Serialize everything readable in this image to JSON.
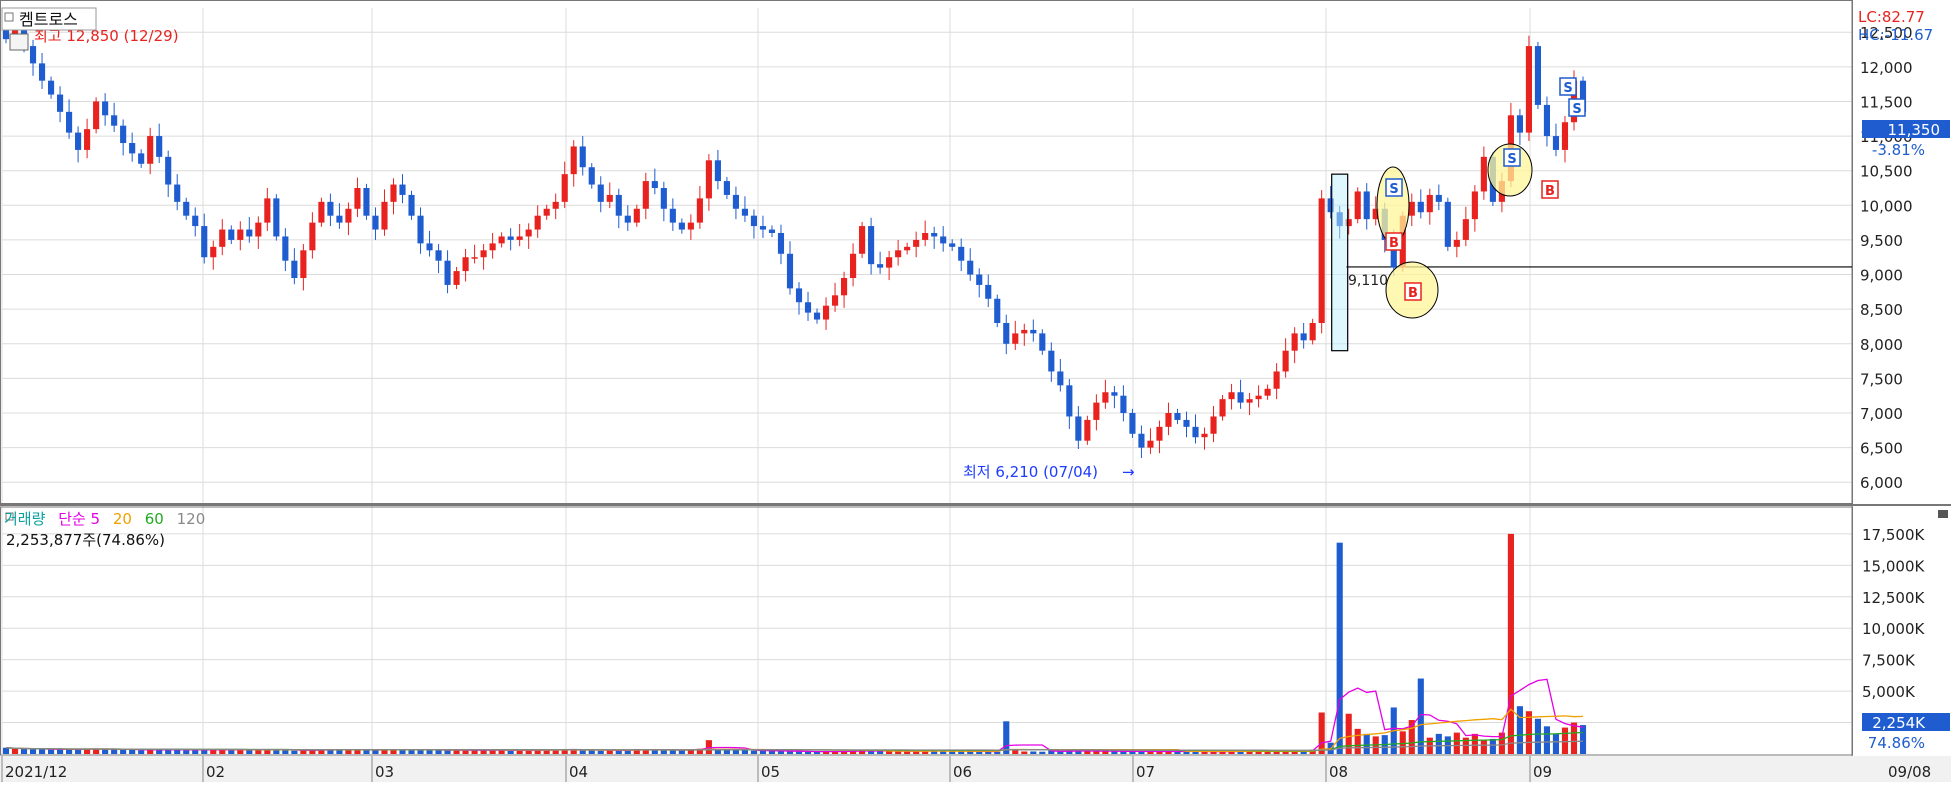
{
  "stock": {
    "name": "켐트로스",
    "high_label": "최고 12,850 (12/29)",
    "low_label": "최저 6,210 (07/04)",
    "lc_label": "LC:82.77",
    "hc_label": "HC:-11.67",
    "last_price": "11,350",
    "change_pct": "-3.81%",
    "support_label": "9,110"
  },
  "volume_panel": {
    "title": "거래량",
    "ma_labels": [
      "단순 5",
      "20",
      "60",
      "120"
    ],
    "info": "2,253,877주(74.86%)",
    "last_volume": "2,254K",
    "last_pct": "74.86%"
  },
  "colors": {
    "up": "#e8231f",
    "down": "#1e5ccf",
    "grid": "#dcdcdc",
    "ma5": "#e400e4",
    "ma20": "#f0a000",
    "ma60": "#22aa22",
    "ma120": "#888888",
    "highlight": "#fff59a"
  },
  "chart_data": [
    {
      "type": "candlestick",
      "title": "켐트로스",
      "x_tick_labels": [
        "2021/12",
        "02",
        "03",
        "04",
        "05",
        "06",
        "07",
        "08",
        "09",
        "09/08"
      ],
      "y_ticks": [
        6000,
        6500,
        7000,
        7500,
        8000,
        8500,
        9000,
        9500,
        10000,
        10500,
        11000,
        11500,
        12000,
        12500
      ],
      "y_tick_labels": [
        "6,000",
        "6,500",
        "7,000",
        "7,500",
        "8,000",
        "8,500",
        "9,000",
        "9,500",
        "10,000",
        "10,500",
        "11,000",
        "11,500",
        "12,000",
        "12,500"
      ],
      "ylim": [
        5700,
        12850
      ],
      "grid": true,
      "close": [
        12400,
        12600,
        12300,
        12050,
        11800,
        11600,
        11350,
        11050,
        10800,
        11100,
        11500,
        11300,
        11150,
        10900,
        10750,
        10600,
        11000,
        10700,
        10300,
        10050,
        9850,
        9700,
        9250,
        9400,
        9650,
        9500,
        9650,
        9550,
        9750,
        10100,
        9550,
        9200,
        8950,
        9350,
        9750,
        10050,
        9850,
        9750,
        9950,
        10250,
        9850,
        9650,
        10050,
        10300,
        10150,
        9850,
        9450,
        9350,
        9200,
        8850,
        9050,
        9250,
        9250,
        9350,
        9450,
        9550,
        9500,
        9550,
        9650,
        9850,
        9950,
        10050,
        10450,
        10850,
        10550,
        10300,
        10050,
        10150,
        9850,
        9750,
        9950,
        10350,
        10250,
        9950,
        9750,
        9650,
        9750,
        10100,
        10650,
        10350,
        10150,
        9950,
        9850,
        9700,
        9650,
        9600,
        9300,
        8800,
        8600,
        8450,
        8350,
        8550,
        8700,
        8950,
        9300,
        9700,
        9150,
        9100,
        9250,
        9350,
        9400,
        9500,
        9600,
        9550,
        9450,
        9400,
        9200,
        9000,
        8850,
        8650,
        8300,
        8000,
        8150,
        8200,
        8150,
        7900,
        7600,
        7400,
        6950,
        6600,
        6900,
        7150,
        7300,
        7250,
        7000,
        6700,
        6500,
        6600,
        6800,
        7000,
        6900,
        6800,
        6650,
        6700,
        6950,
        7200,
        7300,
        7150,
        7200,
        7250,
        7350,
        7600,
        7900,
        8150,
        8050,
        8300,
        10100,
        9900,
        9700,
        9800,
        10200,
        9800,
        9950,
        9500,
        9100,
        9850,
        10050,
        9900,
        10150,
        10050,
        9400,
        9500,
        9800,
        10200,
        10700,
        10050,
        10350,
        11300,
        11050,
        12300,
        11450,
        11000,
        10800,
        11200,
        11800,
        11350
      ],
      "volume_k": [
        500,
        400,
        420,
        380,
        360,
        350,
        420,
        380,
        360,
        400,
        420,
        380,
        360,
        340,
        320,
        300,
        380,
        340,
        360,
        320,
        300,
        340,
        320,
        360,
        340,
        300,
        320,
        300,
        360,
        380,
        300,
        280,
        260,
        300,
        320,
        380,
        340,
        300,
        320,
        360,
        320,
        300,
        320,
        360,
        380,
        300,
        340,
        320,
        300,
        280,
        300,
        300,
        320,
        300,
        280,
        300,
        260,
        280,
        300,
        320,
        340,
        360,
        380,
        380,
        300,
        280,
        260,
        300,
        320,
        300,
        400,
        360,
        320,
        300,
        280,
        300,
        380,
        420,
        1100,
        380,
        320,
        300,
        280,
        260,
        250,
        240,
        220,
        200,
        190,
        180,
        170,
        200,
        230,
        200,
        250,
        300,
        240,
        220,
        210,
        220,
        240,
        250,
        260,
        280,
        240,
        230,
        210,
        200,
        190,
        180,
        180,
        2600,
        400,
        200,
        200,
        180,
        300,
        200,
        250,
        280,
        220,
        200,
        210,
        260,
        200,
        190,
        180,
        200,
        210,
        220,
        200,
        210,
        190,
        180,
        180,
        200,
        210,
        280,
        190,
        200,
        210,
        200,
        230,
        240,
        300,
        350,
        3300,
        900,
        16800,
        3200,
        2000,
        1600,
        1400,
        1500,
        3700,
        1800,
        2700,
        6000,
        1300,
        1600,
        1400,
        1700,
        1300,
        1600,
        1100,
        1200,
        1700,
        17500,
        3800,
        3400,
        2800,
        2200,
        1600,
        2100,
        2500,
        2300
      ]
    }
  ]
}
